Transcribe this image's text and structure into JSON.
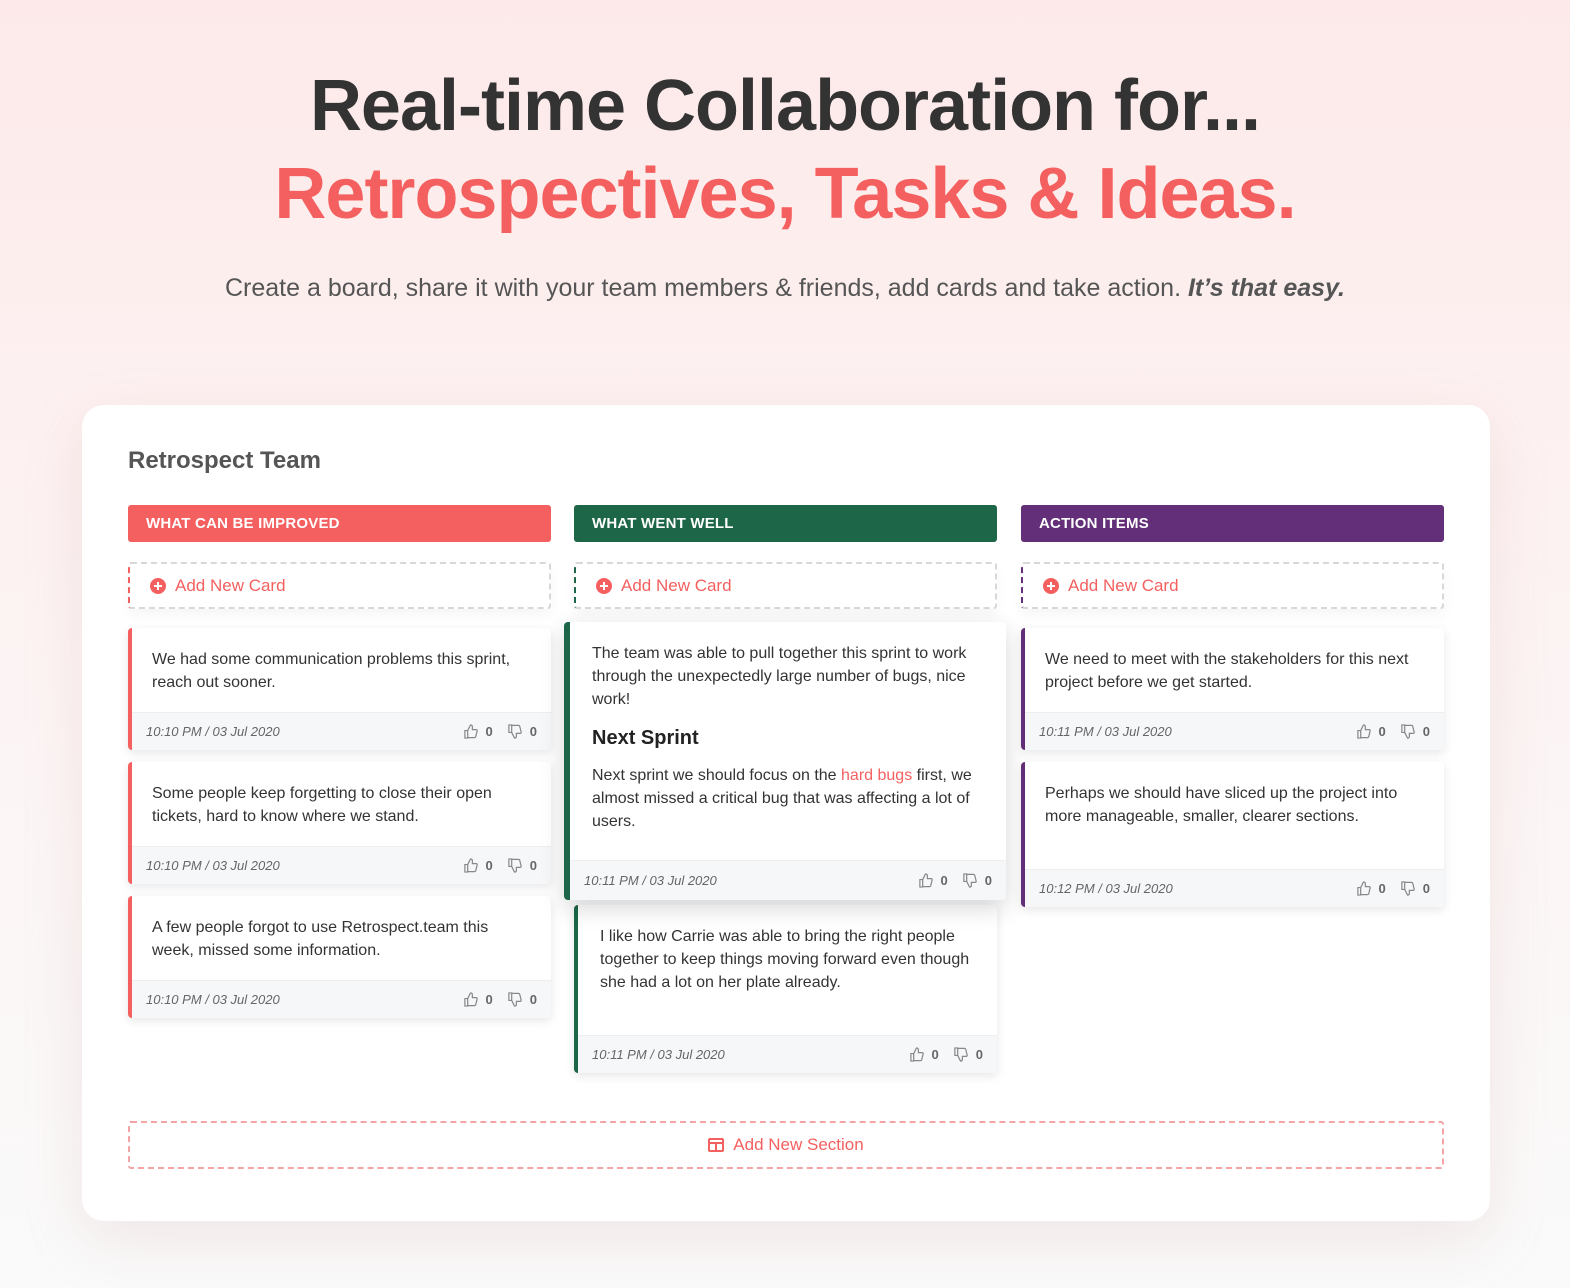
{
  "hero": {
    "title": "Real-time Collaboration for...",
    "title_accent": "Retrospectives, Tasks & Ideas.",
    "subtitle": "Create a board, share it with your team members & friends, add cards and take action.",
    "subtitle_emphasis": "It’s that easy."
  },
  "board": {
    "title": "Retrospect Team",
    "add_card_label": "Add New Card",
    "add_section_label": "Add New Section"
  },
  "colors": {
    "accent": "#f4605f",
    "improve": "#f4605f",
    "went_well": "#1d6648",
    "action": "#632f79"
  },
  "columns": [
    {
      "title": "WHAT CAN BE IMPROVED",
      "cards": [
        {
          "text": "We had some communication problems this sprint, reach out sooner.",
          "timestamp": "10:10 PM / 03 Jul 2020",
          "likes": "0",
          "dislikes": "0"
        },
        {
          "text": "Some people keep forgetting to close their open tickets, hard to know where we stand.",
          "timestamp": "10:10 PM / 03 Jul 2020",
          "likes": "0",
          "dislikes": "0"
        },
        {
          "text": "A few people forgot to use Retrospect.team this week, missed some information.",
          "timestamp": "10:10 PM / 03 Jul 2020",
          "likes": "0",
          "dislikes": "0"
        }
      ]
    },
    {
      "title": "WHAT WENT WELL",
      "cards": [
        {
          "text": "The team was able to pull together this sprint to work through the unexpectedly large number of bugs, nice work!",
          "heading": "Next Sprint",
          "text2_before": "Next sprint we should focus on the ",
          "text2_highlight": "hard bugs",
          "text2_after": " first, we almost missed a critical bug that was affecting a lot of users.",
          "timestamp": "10:11 PM / 03 Jul 2020",
          "likes": "0",
          "dislikes": "0"
        },
        {
          "text": "I like how Carrie was able to bring the right people together to keep things moving forward even though she had a lot on her plate already.",
          "timestamp": "10:11 PM / 03 Jul 2020",
          "likes": "0",
          "dislikes": "0"
        }
      ]
    },
    {
      "title": "ACTION ITEMS",
      "cards": [
        {
          "text": "We need to meet with the stakeholders for this next project before we get started.",
          "timestamp": "10:11 PM / 03 Jul 2020",
          "likes": "0",
          "dislikes": "0"
        },
        {
          "text": "Perhaps we should have sliced up the project into more manageable, smaller, clearer sections.",
          "timestamp": "10:12 PM / 03 Jul 2020",
          "likes": "0",
          "dislikes": "0"
        }
      ]
    }
  ]
}
